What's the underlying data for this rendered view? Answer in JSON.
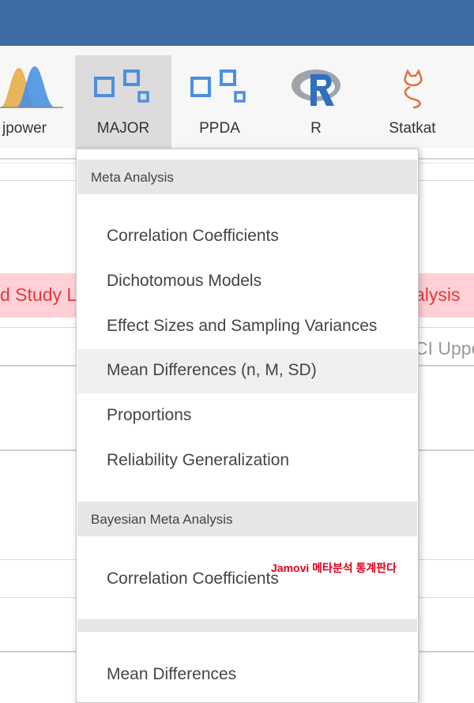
{
  "ribbon": {
    "buttons": [
      {
        "label": "jpower",
        "icon": "bell-curves-icon"
      },
      {
        "label": "MAJOR",
        "icon": "squares-icon"
      },
      {
        "label": "PPDA",
        "icon": "squares-icon"
      },
      {
        "label": "R",
        "icon": "r-logo-icon"
      },
      {
        "label": "Statkat",
        "icon": "statkat-cat-icon"
      }
    ],
    "active": "MAJOR"
  },
  "background": {
    "pink_left": "d Study L",
    "pink_right": "alysis",
    "column_right": "CI Uppe"
  },
  "menu": {
    "sections": [
      {
        "header": "Meta Analysis",
        "items": [
          "Correlation Coefficients",
          "Dichotomous Models",
          "Effect Sizes and Sampling Variances",
          "Mean Differences (n, M, SD)",
          "Proportions",
          "Reliability Generalization"
        ]
      },
      {
        "header": "Bayesian Meta Analysis",
        "items": [
          "Correlation Coefficients"
        ]
      },
      {
        "header": "",
        "items": [
          "Mean Differences"
        ]
      }
    ],
    "highlighted": "Mean Differences (n, M, SD)"
  },
  "watermark": "Jamovi 메타분석 통계판다",
  "colors": {
    "titlebar": "#3e6ca6",
    "accent_blue": "#4a90e2",
    "pink_band": "#ffd1d6",
    "pink_text": "#e23a3a",
    "watermark": "#e0001b"
  }
}
